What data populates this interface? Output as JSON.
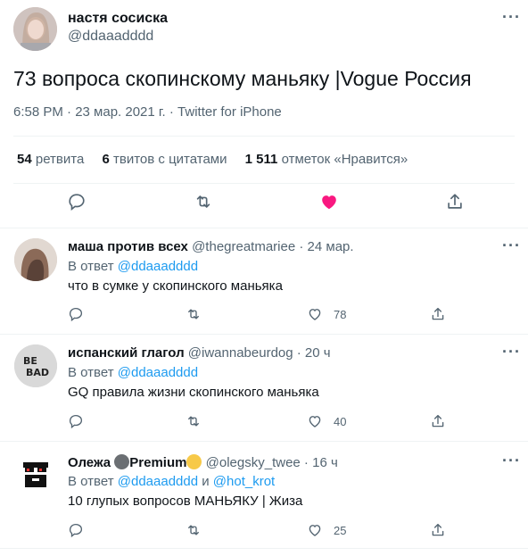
{
  "tweet": {
    "author_name": "настя сосиска",
    "author_handle": "@ddaaadddd",
    "text": "73 вопроса скопинскому маньяку |Vogue Россия",
    "meta": "6:58 PM · 23 мар. 2021 г. · Twitter for iPhone",
    "stats": [
      {
        "count": "54",
        "label": "ретвита"
      },
      {
        "count": "6",
        "label": "твитов с цитатами"
      },
      {
        "count": "1 511",
        "label": "отметок «Нравится»"
      }
    ],
    "liked_color": "#f91880",
    "icon_color": "#536471",
    "link_color": "#1d9bf0"
  },
  "replies": [
    {
      "name": "маша против всех",
      "handle_time": "@thegreatmariee · 24 мар.",
      "in_reply_prefix": "В ответ ",
      "in_reply_links": [
        "@ddaaadddd"
      ],
      "text": "что в сумке у скопинского маньяка",
      "likes": "78"
    },
    {
      "name": "испанский глагол",
      "handle_time": "@iwannabeurdog · 20 ч",
      "in_reply_prefix": "В ответ ",
      "in_reply_links": [
        "@ddaaadddd"
      ],
      "text": "GQ правила жизни скопинского маньяка",
      "likes": "40",
      "avatar_text": "BE BAD"
    },
    {
      "name": "Олежа",
      "name_suffix": "Premium",
      "handle_time": "@olegsky_twee · 16 ч",
      "in_reply_prefix": "В ответ ",
      "in_reply_links": [
        "@ddaaadddd",
        "@hot_krot"
      ],
      "in_reply_joiner": " и ",
      "text": "10 глупых вопросов МАНЬЯКУ | Жиза",
      "likes": "25"
    }
  ]
}
